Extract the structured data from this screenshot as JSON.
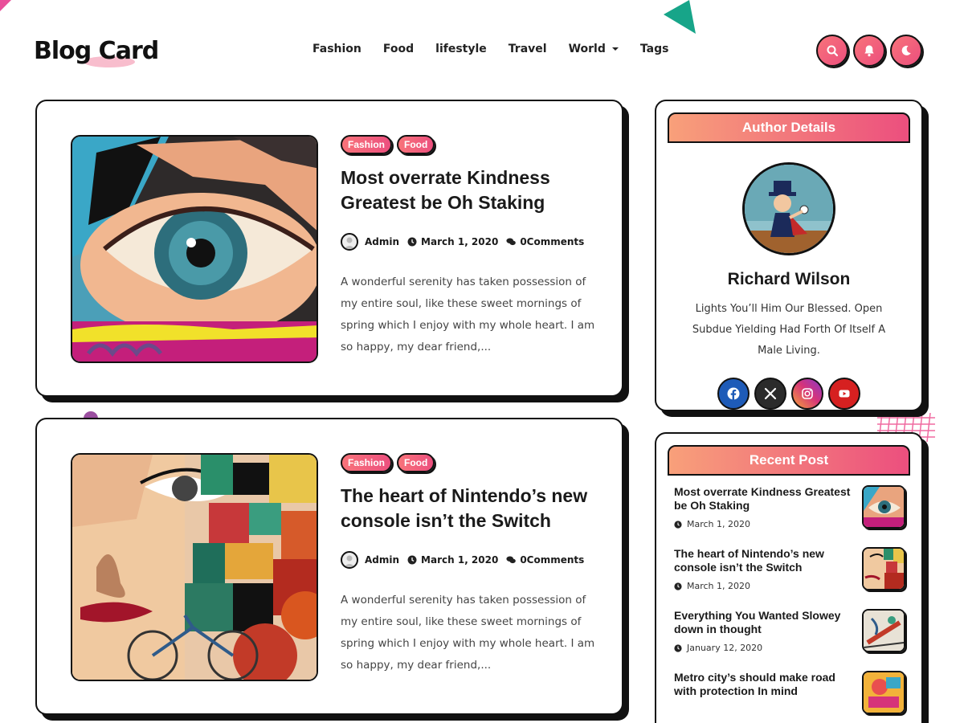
{
  "site": {
    "logo": "Blog Card",
    "nav": [
      {
        "label": "Fashion"
      },
      {
        "label": "Food"
      },
      {
        "label": "lifestyle"
      },
      {
        "label": "Travel"
      },
      {
        "label": "World",
        "has_dropdown": true
      },
      {
        "label": "Tags"
      }
    ],
    "header_icons": [
      "search-icon",
      "bell-icon",
      "moon-icon"
    ],
    "accent_gradient": [
      "#f8737a",
      "#ec4f7e"
    ]
  },
  "posts": [
    {
      "tags": [
        "Fashion",
        "Food"
      ],
      "title": "Most overrate Kindness Greatest be Oh Staking",
      "author": "Admin",
      "date": "March 1, 2020",
      "comments": "0Comments",
      "excerpt": "A wonderful serenity has taken possession of my entire soul, like these sweet mornings of spring which I enjoy with my whole heart. I am so happy, my dear friend,..."
    },
    {
      "tags": [
        "Fashion",
        "Food"
      ],
      "title": "The heart of Nintendo’s new console isn’t the Switch",
      "author": "Admin",
      "date": "March 1, 2020",
      "comments": "0Comments",
      "excerpt": "A wonderful serenity has taken possession of my entire soul, like these sweet mornings of spring which I enjoy with my whole heart. I am so happy, my dear friend,..."
    }
  ],
  "author_widget": {
    "heading": "Author Details",
    "name": "Richard Wilson",
    "bio": "Lights You’ll Him Our Blessed. Open Subdue Yielding Had Forth Of Itself A Male Living.",
    "socials": [
      {
        "icon": "facebook-icon",
        "color": "#1e5bb8"
      },
      {
        "icon": "x-icon",
        "color": "#2b2b2b"
      },
      {
        "icon": "instagram-icon",
        "color": "#d6337a"
      },
      {
        "icon": "youtube-icon",
        "color": "#d62020"
      }
    ]
  },
  "recent_widget": {
    "heading": "Recent Post",
    "items": [
      {
        "title": "Most overrate Kindness Greatest be Oh Staking",
        "date": "March 1, 2020"
      },
      {
        "title": "The heart of Nintendo’s new console isn’t the Switch",
        "date": "March 1, 2020"
      },
      {
        "title": "Everything You Wanted Slowey down in thought",
        "date": "January 12, 2020"
      },
      {
        "title": "Metro city’s should make road with protection In mind",
        "date": ""
      }
    ]
  }
}
